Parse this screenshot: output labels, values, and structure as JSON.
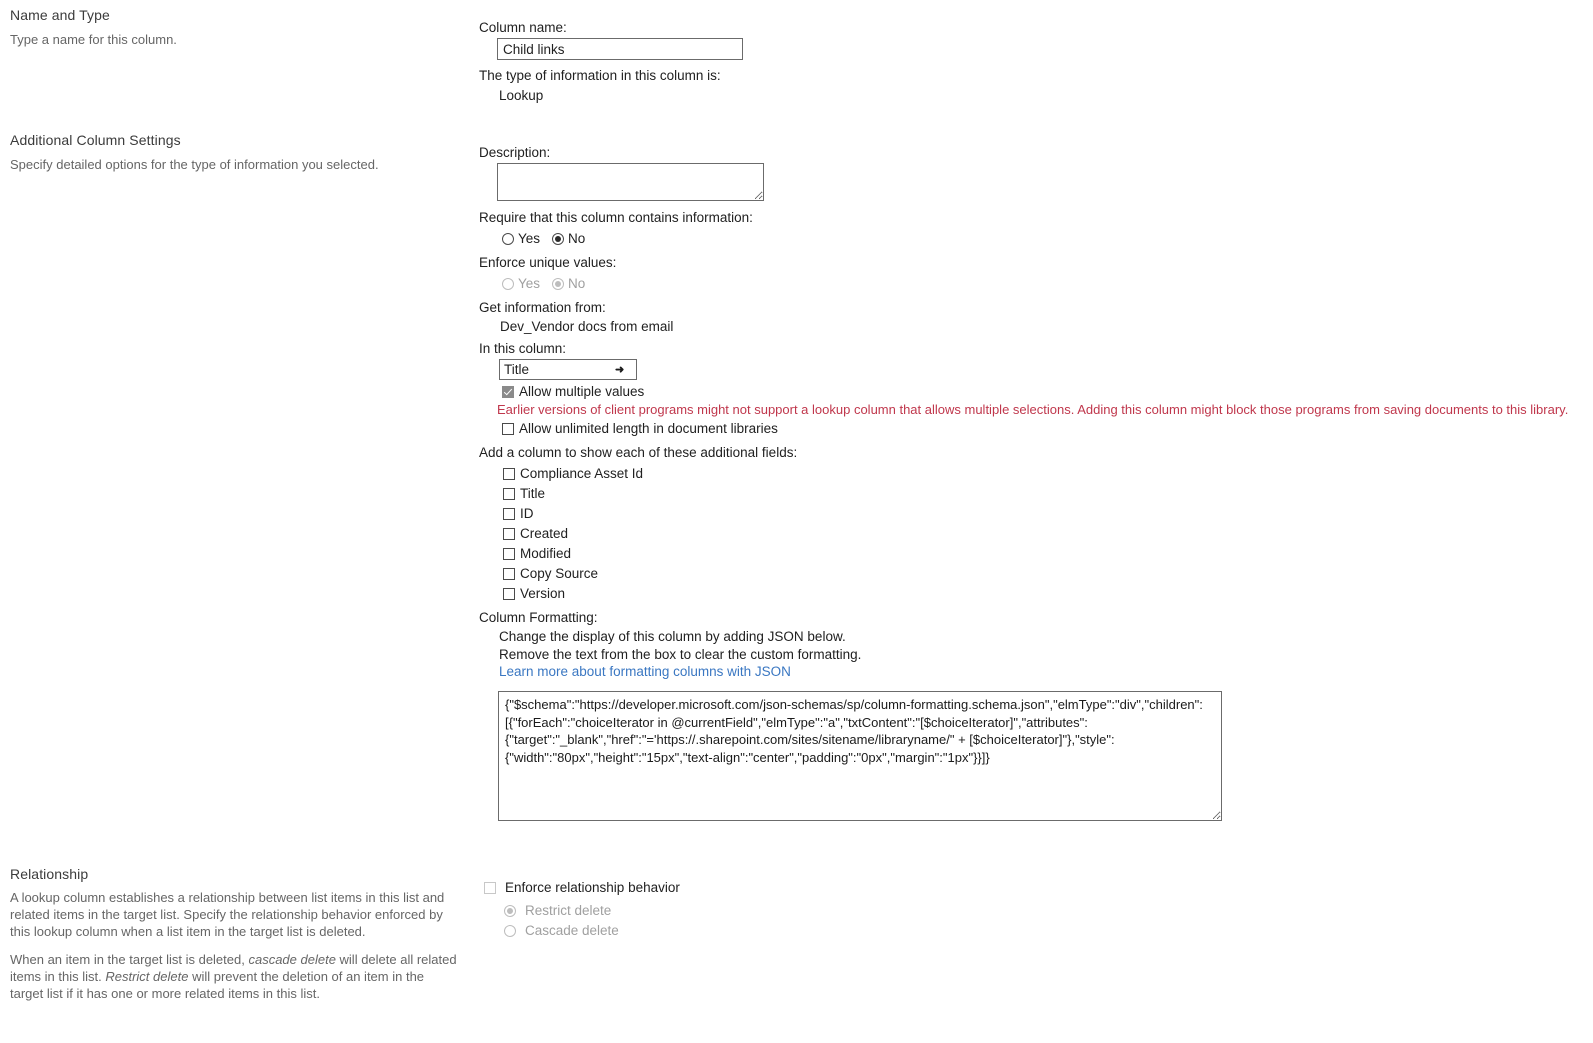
{
  "name_and_type": {
    "heading": "Name and Type",
    "description": "Type a name for this column.",
    "column_name_label": "Column name:",
    "column_name_value": "Child links",
    "type_label": "The type of information in this column is:",
    "type_value": "Lookup"
  },
  "additional_settings": {
    "heading": "Additional Column Settings",
    "description": "Specify detailed options for the type of information you selected.",
    "description_label": "Description:",
    "description_value": "",
    "require_label": "Require that this column contains information:",
    "require_yes": "Yes",
    "require_no": "No",
    "require_selected": "No",
    "unique_label": "Enforce unique values:",
    "unique_yes": "Yes",
    "unique_no": "No",
    "unique_selected": "No",
    "get_info_label": "Get information from:",
    "get_info_value": "Dev_Vendor docs from email",
    "in_column_label": "In this column:",
    "in_column_value": "Title",
    "in_column_options": [
      "Title"
    ],
    "allow_multiple_label": "Allow multiple values",
    "allow_multiple_checked": true,
    "multiple_warning": "Earlier versions of client programs might not support a lookup column that allows multiple selections. Adding this column might block those programs from saving documents to this library.",
    "allow_unlimited_label": "Allow unlimited length in document libraries",
    "allow_unlimited_checked": false,
    "additional_fields_label": "Add a column to show each of these additional fields:",
    "additional_fields": [
      {
        "label": "Compliance Asset Id",
        "checked": false
      },
      {
        "label": "Title",
        "checked": false
      },
      {
        "label": "ID",
        "checked": false
      },
      {
        "label": "Created",
        "checked": false
      },
      {
        "label": "Modified",
        "checked": false
      },
      {
        "label": "Copy Source",
        "checked": false
      },
      {
        "label": "Version",
        "checked": false
      }
    ],
    "column_formatting_label": "Column Formatting:",
    "formatting_line1": "Change the display of this column by adding JSON below.",
    "formatting_line2": "Remove the text from the box to clear the custom formatting.",
    "formatting_link": "Learn more about formatting columns with JSON",
    "json_value": "{\"$schema\":\"https://developer.microsoft.com/json-schemas/sp/column-formatting.schema.json\",\"elmType\":\"div\",\"children\":\n[{\"forEach\":\"choiceIterator in @currentField\",\"elmType\":\"a\",\"txtContent\":\"[$choiceIterator]\",\"attributes\":\n{\"target\":\"_blank\",\"href\":\"='https://.sharepoint.com/sites/sitename/libraryname/\" + [$choiceIterator]\"},\"style\":\n{\"width\":\"80px\",\"height\":\"15px\",\"text-align\":\"center\",\"padding\":\"0px\",\"margin\":\"1px\"}}]}"
  },
  "relationship": {
    "heading": "Relationship",
    "description_p1": "A lookup column establishes a relationship between list items in this list and related items in the target list. Specify the relationship behavior enforced by this lookup column when a list item in the target list is deleted.",
    "description_p2_pre": "When an item in the target list is deleted, ",
    "description_p2_em1": "cascade delete",
    "description_p2_mid": " will delete all related items in this list. ",
    "description_p2_em2": "Restrict delete",
    "description_p2_post": " will prevent the deletion of an item in the target list if it has one or more related items in this list.",
    "enforce_label": "Enforce relationship behavior",
    "enforce_checked": false,
    "restrict_label": "Restrict delete",
    "cascade_label": "Cascade delete",
    "behavior_selected": "Restrict delete"
  },
  "colors": {
    "warning": "#c0374c",
    "link": "#3a77c2",
    "text": "#212121",
    "muted": "#666666"
  }
}
